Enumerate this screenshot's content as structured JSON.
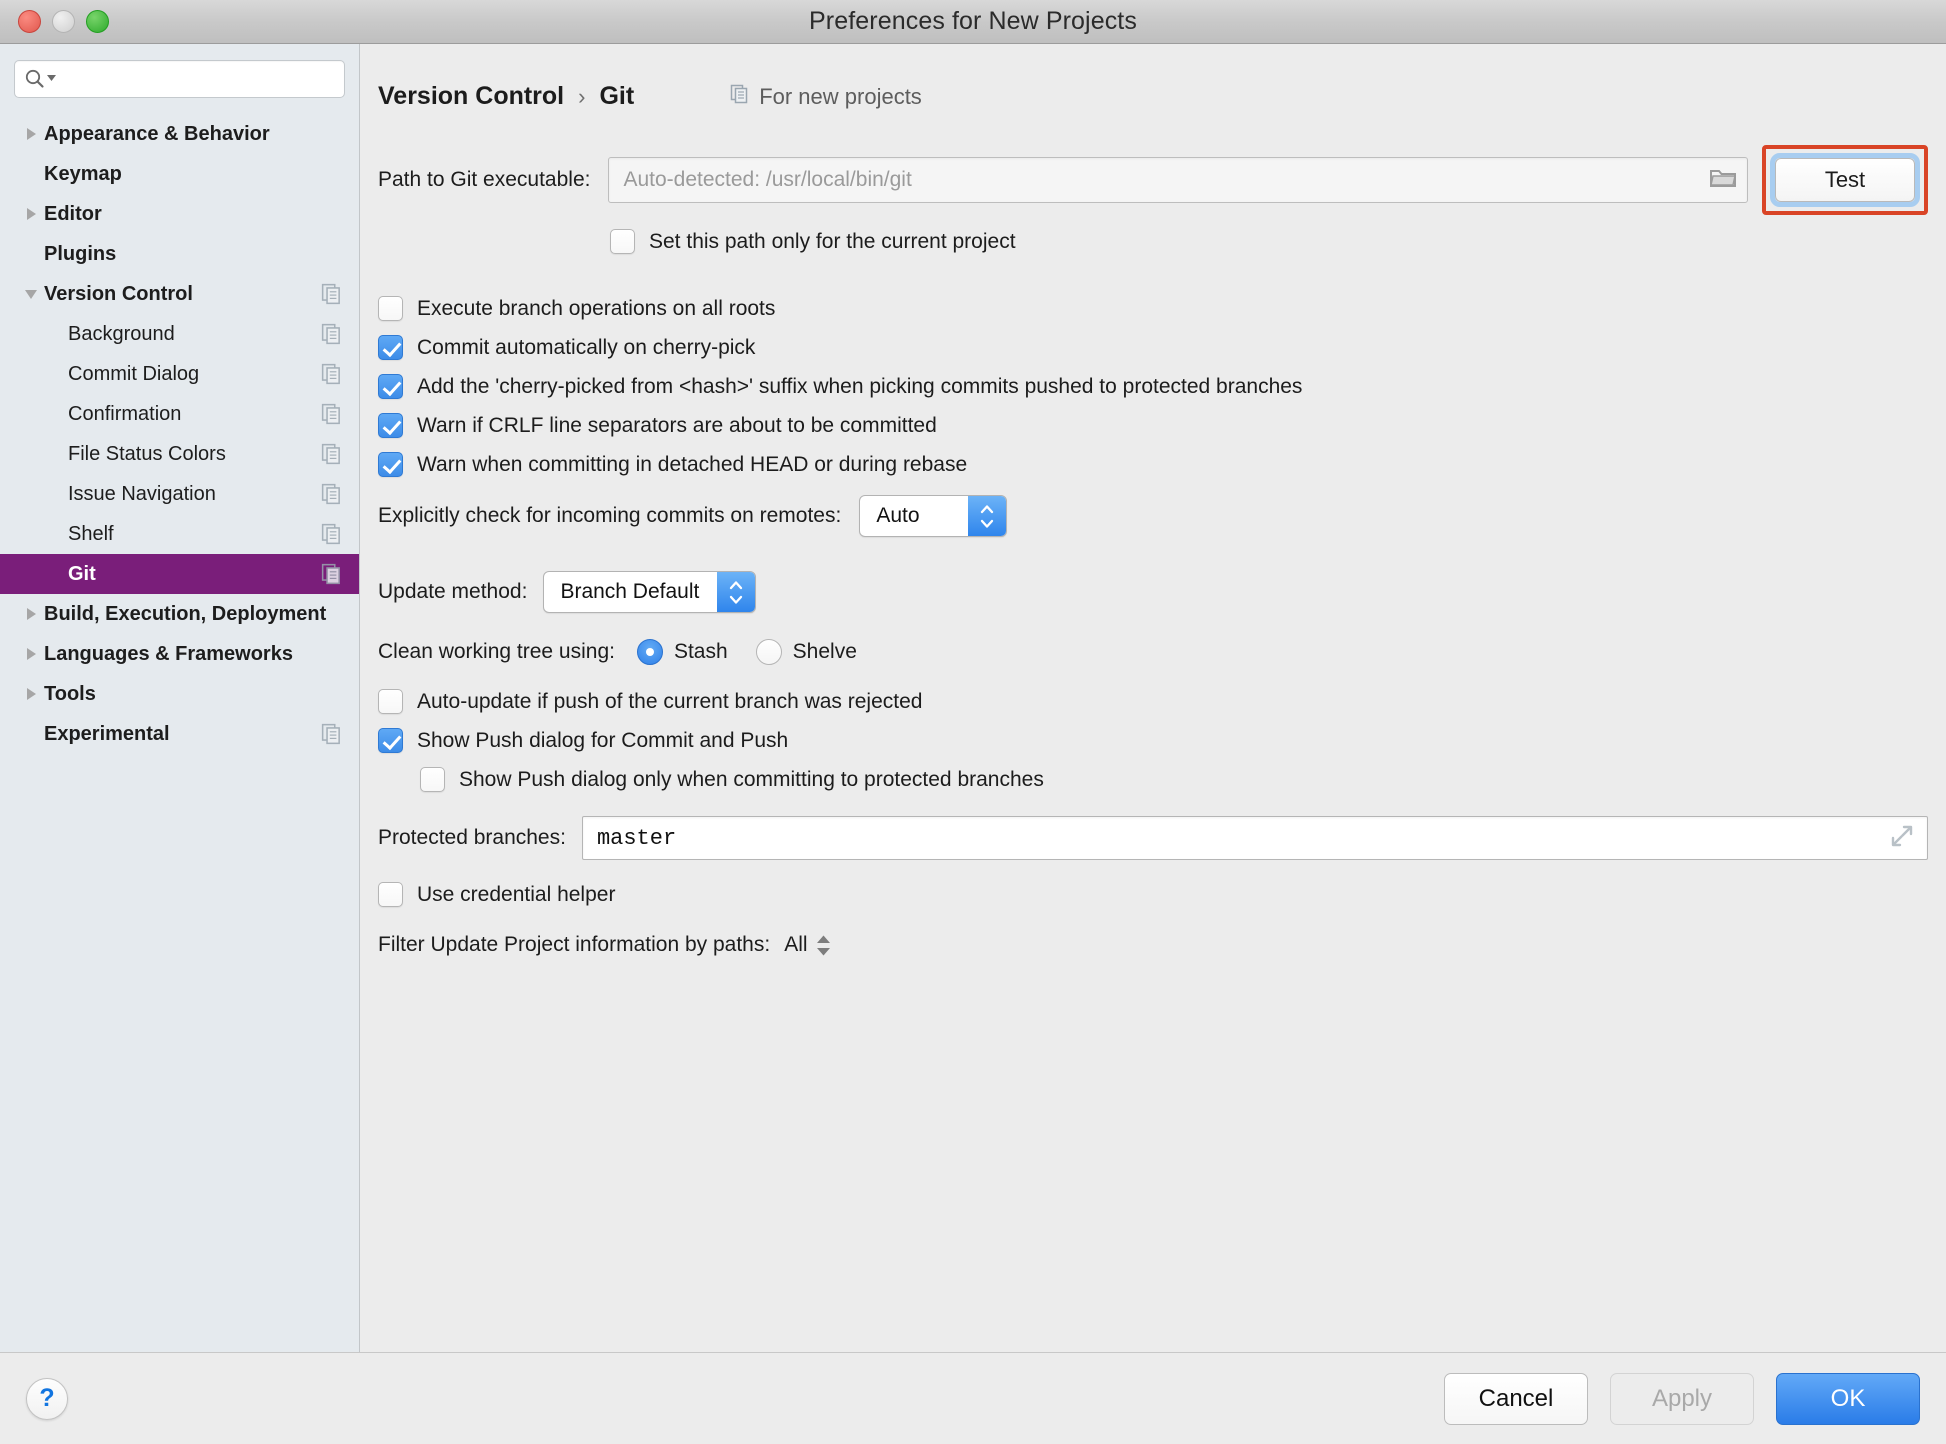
{
  "window": {
    "title": "Preferences for New Projects",
    "close_label": "close",
    "minimize_label": "minimize",
    "zoom_label": "zoom"
  },
  "sidebar": {
    "search": {
      "value": "",
      "placeholder": ""
    },
    "items": [
      {
        "label": "Appearance & Behavior",
        "level": 0,
        "arrow": "right",
        "copy": false,
        "selected": false
      },
      {
        "label": "Keymap",
        "level": 0,
        "arrow": "none",
        "copy": false,
        "selected": false
      },
      {
        "label": "Editor",
        "level": 0,
        "arrow": "right",
        "copy": false,
        "selected": false
      },
      {
        "label": "Plugins",
        "level": 0,
        "arrow": "none",
        "copy": false,
        "selected": false
      },
      {
        "label": "Version Control",
        "level": 0,
        "arrow": "down",
        "copy": true,
        "selected": false
      },
      {
        "label": "Background",
        "level": 1,
        "arrow": "none",
        "copy": true,
        "selected": false
      },
      {
        "label": "Commit Dialog",
        "level": 1,
        "arrow": "none",
        "copy": true,
        "selected": false
      },
      {
        "label": "Confirmation",
        "level": 1,
        "arrow": "none",
        "copy": true,
        "selected": false
      },
      {
        "label": "File Status Colors",
        "level": 1,
        "arrow": "none",
        "copy": true,
        "selected": false
      },
      {
        "label": "Issue Navigation",
        "level": 1,
        "arrow": "none",
        "copy": true,
        "selected": false
      },
      {
        "label": "Shelf",
        "level": 1,
        "arrow": "none",
        "copy": true,
        "selected": false
      },
      {
        "label": "Git",
        "level": 1,
        "arrow": "none",
        "copy": true,
        "selected": true
      },
      {
        "label": "Build, Execution, Deployment",
        "level": 0,
        "arrow": "right",
        "copy": false,
        "selected": false
      },
      {
        "label": "Languages & Frameworks",
        "level": 0,
        "arrow": "right",
        "copy": false,
        "selected": false
      },
      {
        "label": "Tools",
        "level": 0,
        "arrow": "right",
        "copy": false,
        "selected": false
      },
      {
        "label": "Experimental",
        "level": 0,
        "arrow": "none",
        "copy": true,
        "selected": false
      }
    ]
  },
  "main": {
    "breadcrumb": {
      "parent": "Version Control",
      "separator": "›",
      "current": "Git",
      "scope_label": "For new projects"
    },
    "path_row": {
      "label": "Path to Git executable:",
      "placeholder": "Auto-detected: /usr/local/bin/git",
      "value": "",
      "browse_icon": "folder-icon",
      "test_button": "Test",
      "test_highlight_color": "#d94426",
      "test_focus_color": "#a8cdf0"
    },
    "set_path_only": {
      "label": "Set this path only for the current project",
      "checked": false
    },
    "options": [
      {
        "label": "Execute branch operations on all roots",
        "checked": false
      },
      {
        "label": "Commit automatically on cherry-pick",
        "checked": true
      },
      {
        "label": "Add the 'cherry-picked from <hash>' suffix when picking commits pushed to protected branches",
        "checked": true
      },
      {
        "label": "Warn if CRLF line separators are about to be committed",
        "checked": true
      },
      {
        "label": "Warn when committing in detached HEAD or during rebase",
        "checked": true
      }
    ],
    "incoming_commits": {
      "label": "Explicitly check for incoming commits on remotes:",
      "value": "Auto"
    },
    "update_method": {
      "label": "Update method:",
      "value": "Branch Default"
    },
    "clean_tree": {
      "label": "Clean working tree using:",
      "options": [
        {
          "label": "Stash",
          "selected": true
        },
        {
          "label": "Shelve",
          "selected": false
        }
      ]
    },
    "push_options": [
      {
        "label": "Auto-update if push of the current branch was rejected",
        "checked": false,
        "indent": false
      },
      {
        "label": "Show Push dialog for Commit and Push",
        "checked": true,
        "indent": false
      },
      {
        "label": "Show Push dialog only when committing to protected branches",
        "checked": false,
        "indent": true
      }
    ],
    "protected_branches": {
      "label": "Protected branches:",
      "value": "master",
      "expand_icon": "expand-icon"
    },
    "credential_helper": {
      "label": "Use credential helper",
      "checked": false
    },
    "filter_paths": {
      "label": "Filter Update Project information by paths:",
      "value": "All"
    }
  },
  "footer": {
    "help_label": "?",
    "cancel_label": "Cancel",
    "apply_label": "Apply",
    "apply_enabled": false,
    "ok_label": "OK",
    "accent_color": "#2a7ce8"
  }
}
